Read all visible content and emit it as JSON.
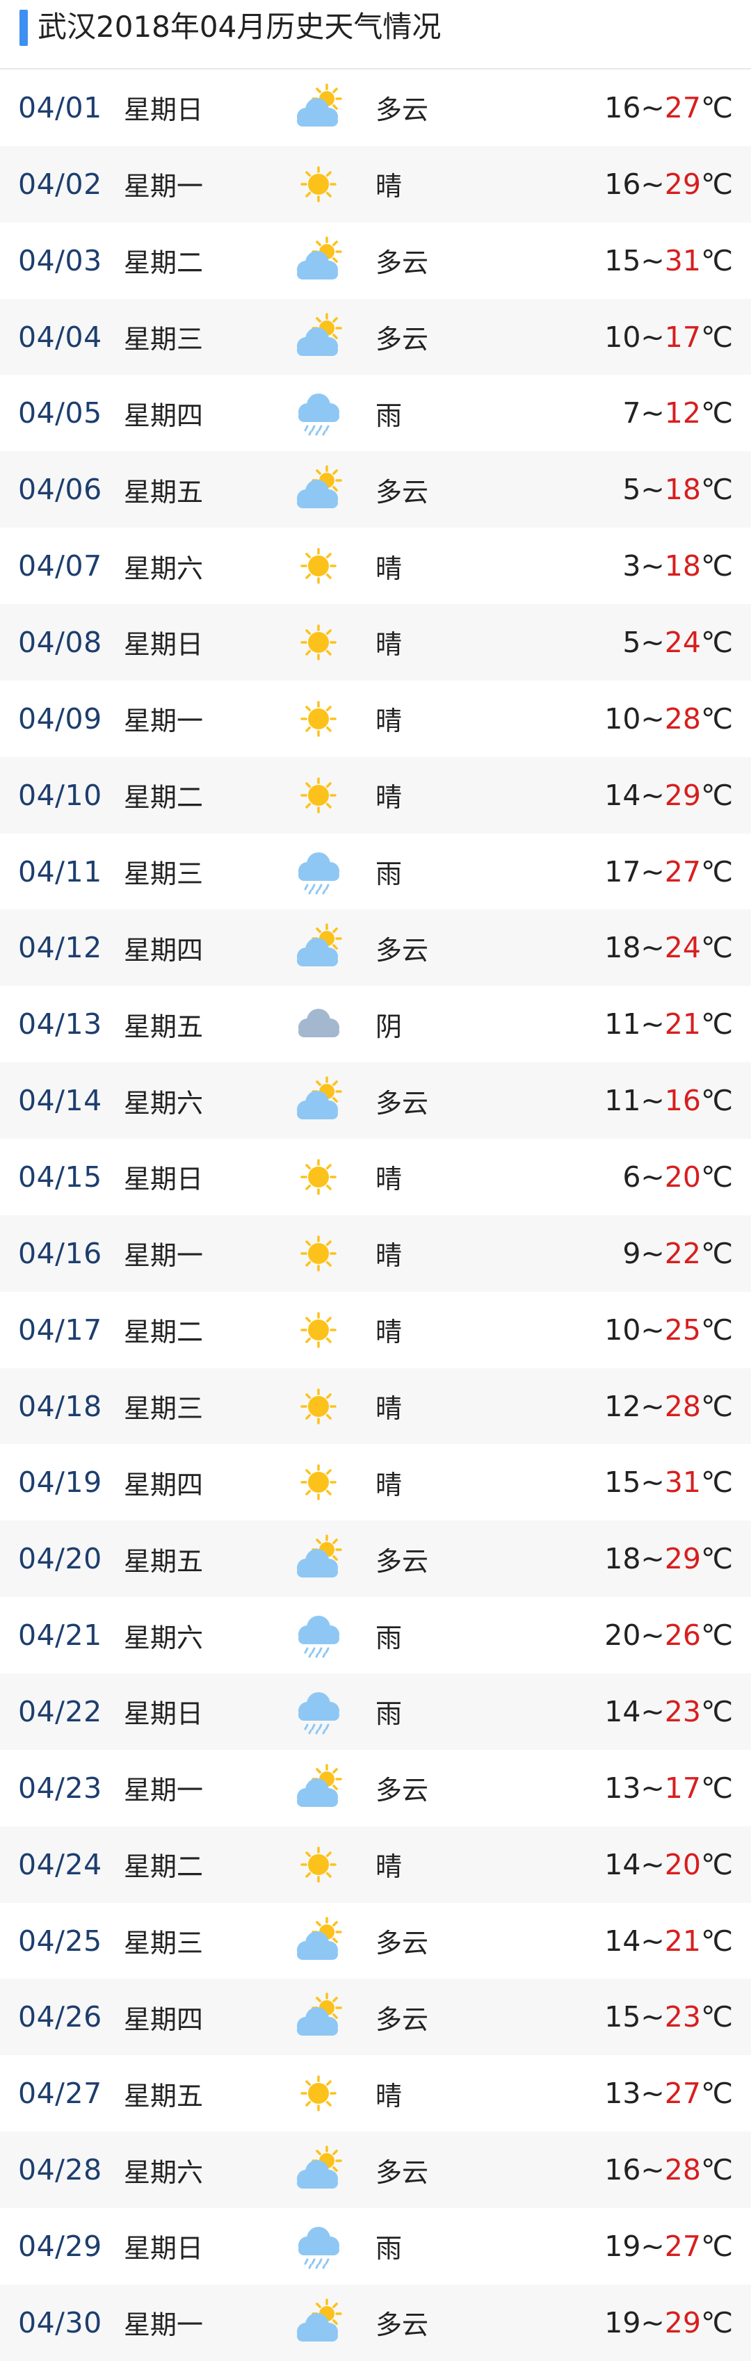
{
  "header": {
    "title": "武汉2018年04月历史天气情况"
  },
  "colors": {
    "accent": "#3d8ff2",
    "date_text": "#1d3e6e",
    "high_temp": "#d81e1e",
    "row_alt_bg": "#f7f7f7",
    "sun": "#fcc21b",
    "cloud": "#8ec7f4",
    "overcast": "#a3b7cf"
  },
  "temp_unit": "℃",
  "temp_separator": "~",
  "days": [
    {
      "date": "04/01",
      "weekday": "星期日",
      "icon": "partly-cloudy-icon",
      "cond": "多云",
      "low": "16",
      "high": "27"
    },
    {
      "date": "04/02",
      "weekday": "星期一",
      "icon": "sunny-icon",
      "cond": "晴",
      "low": "16",
      "high": "29"
    },
    {
      "date": "04/03",
      "weekday": "星期二",
      "icon": "partly-cloudy-icon",
      "cond": "多云",
      "low": "15",
      "high": "31"
    },
    {
      "date": "04/04",
      "weekday": "星期三",
      "icon": "partly-cloudy-icon",
      "cond": "多云",
      "low": "10",
      "high": "17"
    },
    {
      "date": "04/05",
      "weekday": "星期四",
      "icon": "rain-icon",
      "cond": "雨",
      "low": "7",
      "high": "12"
    },
    {
      "date": "04/06",
      "weekday": "星期五",
      "icon": "partly-cloudy-icon",
      "cond": "多云",
      "low": "5",
      "high": "18"
    },
    {
      "date": "04/07",
      "weekday": "星期六",
      "icon": "sunny-icon",
      "cond": "晴",
      "low": "3",
      "high": "18"
    },
    {
      "date": "04/08",
      "weekday": "星期日",
      "icon": "sunny-icon",
      "cond": "晴",
      "low": "5",
      "high": "24"
    },
    {
      "date": "04/09",
      "weekday": "星期一",
      "icon": "sunny-icon",
      "cond": "晴",
      "low": "10",
      "high": "28"
    },
    {
      "date": "04/10",
      "weekday": "星期二",
      "icon": "sunny-icon",
      "cond": "晴",
      "low": "14",
      "high": "29"
    },
    {
      "date": "04/11",
      "weekday": "星期三",
      "icon": "rain-icon",
      "cond": "雨",
      "low": "17",
      "high": "27"
    },
    {
      "date": "04/12",
      "weekday": "星期四",
      "icon": "partly-cloudy-icon",
      "cond": "多云",
      "low": "18",
      "high": "24"
    },
    {
      "date": "04/13",
      "weekday": "星期五",
      "icon": "overcast-icon",
      "cond": "阴",
      "low": "11",
      "high": "21"
    },
    {
      "date": "04/14",
      "weekday": "星期六",
      "icon": "partly-cloudy-icon",
      "cond": "多云",
      "low": "11",
      "high": "16"
    },
    {
      "date": "04/15",
      "weekday": "星期日",
      "icon": "sunny-icon",
      "cond": "晴",
      "low": "6",
      "high": "20"
    },
    {
      "date": "04/16",
      "weekday": "星期一",
      "icon": "sunny-icon",
      "cond": "晴",
      "low": "9",
      "high": "22"
    },
    {
      "date": "04/17",
      "weekday": "星期二",
      "icon": "sunny-icon",
      "cond": "晴",
      "low": "10",
      "high": "25"
    },
    {
      "date": "04/18",
      "weekday": "星期三",
      "icon": "sunny-icon",
      "cond": "晴",
      "low": "12",
      "high": "28"
    },
    {
      "date": "04/19",
      "weekday": "星期四",
      "icon": "sunny-icon",
      "cond": "晴",
      "low": "15",
      "high": "31"
    },
    {
      "date": "04/20",
      "weekday": "星期五",
      "icon": "partly-cloudy-icon",
      "cond": "多云",
      "low": "18",
      "high": "29"
    },
    {
      "date": "04/21",
      "weekday": "星期六",
      "icon": "rain-icon",
      "cond": "雨",
      "low": "20",
      "high": "26"
    },
    {
      "date": "04/22",
      "weekday": "星期日",
      "icon": "rain-icon",
      "cond": "雨",
      "low": "14",
      "high": "23"
    },
    {
      "date": "04/23",
      "weekday": "星期一",
      "icon": "partly-cloudy-icon",
      "cond": "多云",
      "low": "13",
      "high": "17"
    },
    {
      "date": "04/24",
      "weekday": "星期二",
      "icon": "sunny-icon",
      "cond": "晴",
      "low": "14",
      "high": "20"
    },
    {
      "date": "04/25",
      "weekday": "星期三",
      "icon": "partly-cloudy-icon",
      "cond": "多云",
      "low": "14",
      "high": "21"
    },
    {
      "date": "04/26",
      "weekday": "星期四",
      "icon": "partly-cloudy-icon",
      "cond": "多云",
      "low": "15",
      "high": "23"
    },
    {
      "date": "04/27",
      "weekday": "星期五",
      "icon": "sunny-icon",
      "cond": "晴",
      "low": "13",
      "high": "27"
    },
    {
      "date": "04/28",
      "weekday": "星期六",
      "icon": "partly-cloudy-icon",
      "cond": "多云",
      "low": "16",
      "high": "28"
    },
    {
      "date": "04/29",
      "weekday": "星期日",
      "icon": "rain-icon",
      "cond": "雨",
      "low": "19",
      "high": "27"
    },
    {
      "date": "04/30",
      "weekday": "星期一",
      "icon": "partly-cloudy-icon",
      "cond": "多云",
      "low": "19",
      "high": "29"
    }
  ]
}
